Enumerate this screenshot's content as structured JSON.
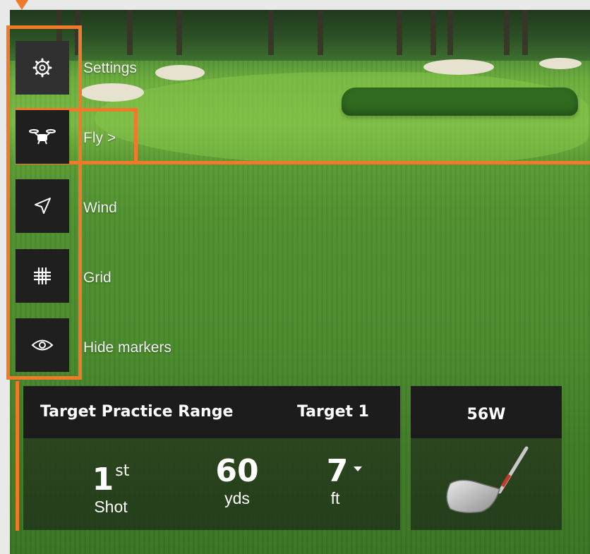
{
  "menu": {
    "items": [
      {
        "id": "settings",
        "label": "Settings",
        "icon": "gear-icon"
      },
      {
        "id": "fly",
        "label": "Fly >",
        "icon": "drone-icon"
      },
      {
        "id": "wind",
        "label": "Wind",
        "icon": "navigation-arrow-icon"
      },
      {
        "id": "grid",
        "label": "Grid",
        "icon": "grid-icon"
      },
      {
        "id": "hide-markers",
        "label": "Hide markers",
        "icon": "eye-icon"
      }
    ]
  },
  "scoreboard": {
    "mode": "Target Practice Range",
    "target": "Target 1",
    "shot_number": "1",
    "shot_suffix": "st",
    "shot_label": "Shot",
    "distance_value": "60",
    "distance_unit": "yds",
    "height_value": "7",
    "height_unit": "ft"
  },
  "club": {
    "name": "56W",
    "icon": "wedge-club-icon"
  },
  "colors": {
    "highlight": "#f2782a",
    "panel_dark": "#1c1c1c",
    "button_dark": "#1f1f1f"
  }
}
